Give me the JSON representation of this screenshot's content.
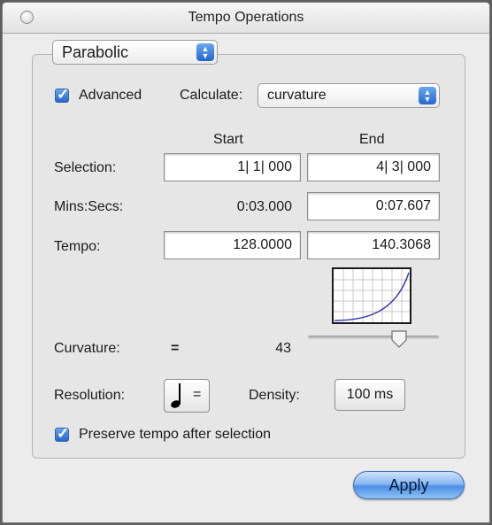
{
  "window": {
    "title": "Tempo Operations"
  },
  "mode_popup": {
    "selected": "Parabolic"
  },
  "advanced": {
    "label": "Advanced",
    "checked": true
  },
  "calculate": {
    "label": "Calculate:",
    "selected": "curvature"
  },
  "columns": {
    "start": "Start",
    "end": "End"
  },
  "selection": {
    "label": "Selection:",
    "start": "1| 1| 000",
    "end": "4| 3| 000"
  },
  "mins_secs": {
    "label": "Mins:Secs:",
    "start": "0:03.000",
    "end": "0:07.607"
  },
  "tempo": {
    "label": "Tempo:",
    "start": "128.0000",
    "end": "140.3068"
  },
  "curvature": {
    "label": "Curvature:",
    "symbol": "=",
    "value": "43"
  },
  "resolution": {
    "label": "Resolution:",
    "note_icon": "quarter-note-icon",
    "equals": "="
  },
  "density": {
    "label": "Density:",
    "value": "100 ms"
  },
  "preserve": {
    "label": "Preserve tempo after selection",
    "checked": true
  },
  "apply": {
    "label": "Apply"
  },
  "colors": {
    "accent": "#2466d0",
    "apply_button": "#6aa6f0",
    "curve": "#3b3bb0"
  }
}
